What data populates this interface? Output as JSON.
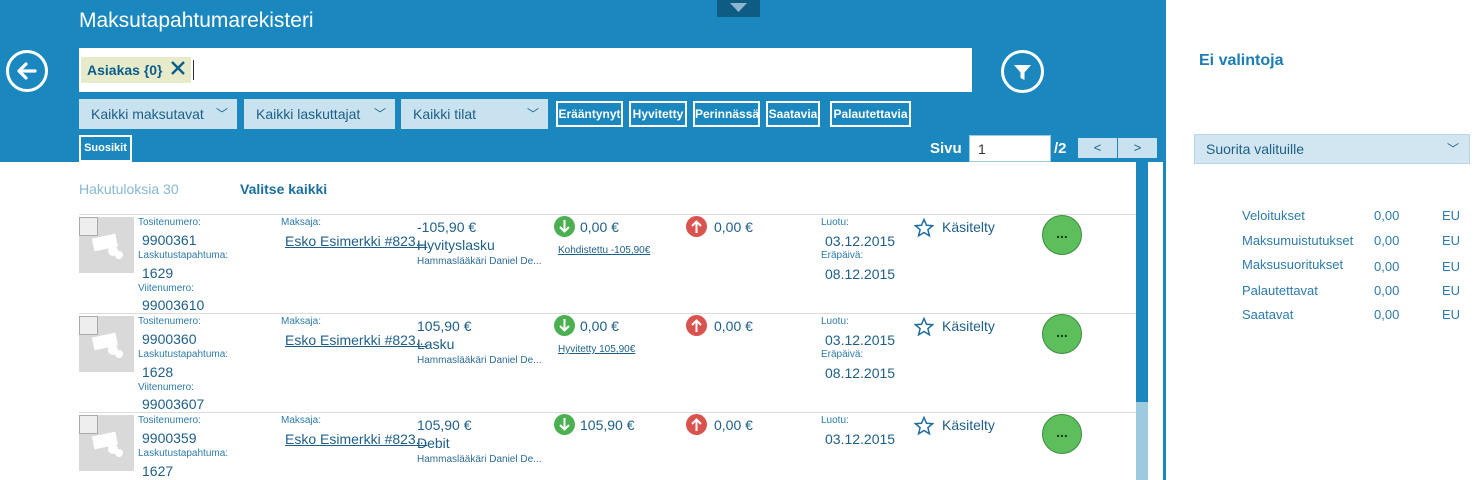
{
  "header": {
    "title": "Maksutapahtumarekisteri",
    "search_chip": "Asiakas {0}",
    "filters": {
      "payment_methods": "Kaikki maksutavat",
      "billers": "Kaikki laskuttajat",
      "states": "Kaikki tilat"
    },
    "tags": [
      "Erääntynyt",
      "Hyvitetty",
      "Perinnässä",
      "Saatavia",
      "Palautettavia"
    ],
    "favorites": "Suosikit",
    "pagination": {
      "label": "Sivu",
      "current": "1",
      "total": "/2",
      "prev": "<",
      "next": ">"
    }
  },
  "list": {
    "results_count": "Hakutuloksia 30",
    "select_all": "Valitse kaikki",
    "labels": {
      "voucher": "Tositenumero:",
      "billing_event": "Laskutustapahtuma:",
      "reference": "Viitenumero:",
      "payer": "Maksaja:",
      "created": "Luotu:",
      "due": "Eräpäivä:"
    },
    "rows": [
      {
        "voucher": "9900361",
        "billing_event": "1629",
        "reference": "99003610",
        "payer": "Esko Esimerkki #823...",
        "amount": "-105,90 €",
        "type": "Hyvityslasku",
        "biller": "Hammaslääkäri Daniel De...",
        "paid": "0,00 €",
        "paid_note": "Kohdistettu -105,90€",
        "returned": "0,00 €",
        "created": "03.12.2015",
        "due": "08.12.2015",
        "status": "Käsitelty",
        "more": "..."
      },
      {
        "voucher": "9900360",
        "billing_event": "1628",
        "reference": "99003607",
        "payer": "Esko Esimerkki #823...",
        "amount": "105,90 €",
        "type": "Lasku",
        "biller": "Hammaslääkäri Daniel De...",
        "paid": "0,00 €",
        "paid_note": "Hyvitetty 105,90€",
        "returned": "0,00 €",
        "created": "03.12.2015",
        "due": "08.12.2015",
        "status": "Käsitelty",
        "more": "..."
      },
      {
        "voucher": "9900359",
        "billing_event": "1627",
        "payer": "Esko Esimerkki #823...",
        "amount": "105,90 €",
        "type": "Debit",
        "biller": "Hammaslääkäri Daniel De...",
        "paid": "105,90 €",
        "returned": "0,00 €",
        "created": "03.12.2015",
        "status": "Käsitelty",
        "more": "..."
      }
    ]
  },
  "side_panel": {
    "selection_title": "Ei valintoja",
    "action_dropdown": "Suorita valituille",
    "summary": [
      {
        "label": "Veloitukset",
        "value": "0,00",
        "unit": "EU"
      },
      {
        "label": "Maksumuistutukset",
        "value": "0,00",
        "unit": "EU"
      },
      {
        "label": "Maksusuoritukset",
        "value": "0,00",
        "unit": "EU"
      },
      {
        "label": "Palautettavat",
        "value": "0,00",
        "unit": "EU"
      },
      {
        "label": "Saatavat",
        "value": "0,00",
        "unit": "EU"
      }
    ]
  },
  "colors": {
    "header_bg": "#1a88be",
    "accent_text": "#1e5f88",
    "green": "#4caf50",
    "red": "#d9534f"
  }
}
